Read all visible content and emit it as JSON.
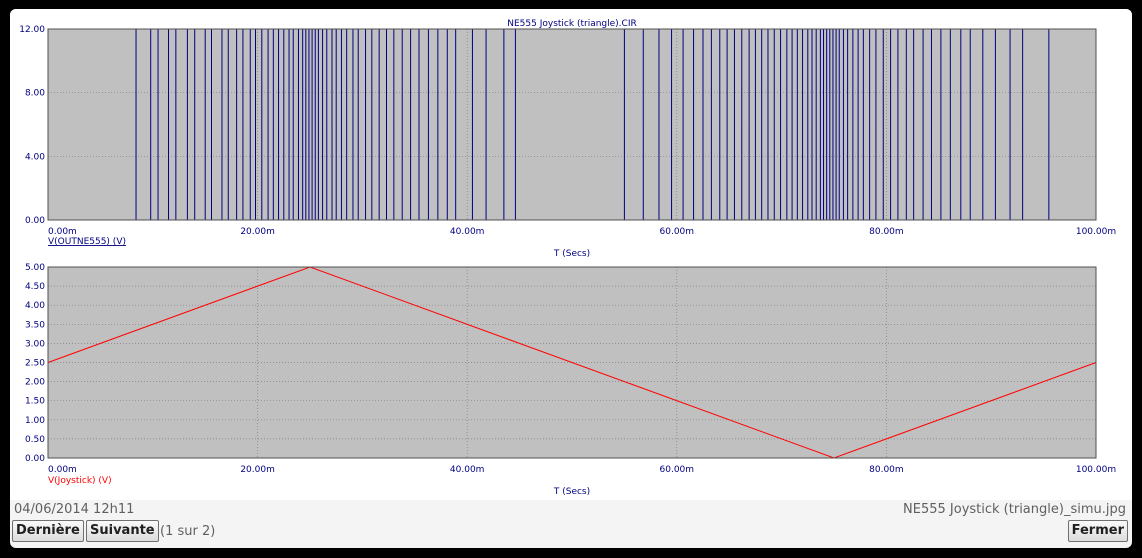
{
  "chart_data": [
    {
      "type": "line",
      "title": "NE555 Joystick (triangle).CIR",
      "xlabel": "T (Secs)",
      "ylabel": "",
      "series": [
        {
          "name": "V(OUTNE555) (V)",
          "color": "#000080"
        }
      ],
      "xlim": [
        0,
        0.1
      ],
      "ylim": [
        0,
        12
      ],
      "x_ticks": [
        "0.00m",
        "20.00m",
        "40.00m",
        "60.00m",
        "80.00m",
        "100.00m"
      ],
      "y_ticks": [
        "0.00",
        "4.00",
        "8.00",
        "12.00"
      ],
      "pulse_edges_ms": [
        8.4,
        9.8,
        10.5,
        11.5,
        12.2,
        13.3,
        14.0,
        15.0,
        15.6,
        16.6,
        17.2,
        18.0,
        18.6,
        19.3,
        19.8,
        20.4,
        21.0,
        21.5,
        22.0,
        22.5,
        23.0,
        23.4,
        23.9,
        24.3,
        24.6,
        24.9,
        25.2,
        25.5,
        25.8,
        26.2,
        26.6,
        27.1,
        27.5,
        28.0,
        28.5,
        29.1,
        29.6,
        30.3,
        30.9,
        31.6,
        32.3,
        33.0,
        33.8,
        34.6,
        35.4,
        36.3,
        37.2,
        38.1,
        38.9,
        40.5,
        41.8,
        43.5,
        44.6,
        55.0,
        56.8,
        58.3,
        59.5,
        60.6,
        61.6,
        62.5,
        63.3,
        64.1,
        64.8,
        65.5,
        66.2,
        66.9,
        67.5,
        68.1,
        68.7,
        69.3,
        69.9,
        70.5,
        71.0,
        71.5,
        72.0,
        72.5,
        72.9,
        73.3,
        73.7,
        74.0,
        74.3,
        74.6,
        74.9,
        75.2,
        75.5,
        75.9,
        76.3,
        76.8,
        77.3,
        77.8,
        78.4,
        79.0,
        79.7,
        80.4,
        81.1,
        81.9,
        82.6,
        83.5,
        84.3,
        85.2,
        86.1,
        87.1,
        88.0,
        89.2,
        90.4,
        91.8,
        93.0,
        95.5
      ],
      "low": 0,
      "high": 12
    },
    {
      "type": "line",
      "title": "",
      "xlabel": "T (Secs)",
      "ylabel": "",
      "series": [
        {
          "name": "V(Joystick) (V)",
          "color": "#ff0000",
          "x_ms": [
            0,
            25,
            75,
            100
          ],
          "y": [
            2.5,
            5.0,
            0.0,
            2.5
          ]
        }
      ],
      "xlim": [
        0,
        0.1
      ],
      "ylim": [
        0,
        5
      ],
      "x_ticks": [
        "0.00m",
        "20.00m",
        "40.00m",
        "60.00m",
        "80.00m",
        "100.00m"
      ],
      "y_ticks": [
        "0.00",
        "0.50",
        "1.00",
        "1.50",
        "2.00",
        "2.50",
        "3.00",
        "3.50",
        "4.00",
        "4.50",
        "5.00"
      ]
    }
  ],
  "colors": {
    "plot_bg": "#c0c0c0",
    "grid": "#808080",
    "axis_text": "#000080",
    "trace_top": "#000080",
    "trace_bottom": "#ff0000"
  },
  "footer": {
    "date": "04/06/2014 12h11",
    "filename": "NE555 Joystick (triangle)_simu.jpg",
    "pager": "(1 sur 2)",
    "buttons": {
      "last": "Dernière",
      "next": "Suivante",
      "close": "Fermer"
    }
  }
}
